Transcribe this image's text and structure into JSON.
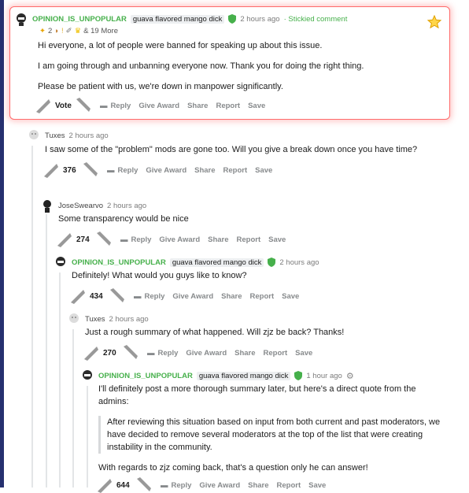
{
  "comments": [
    {
      "username": "OPINION_IS_UNPOPULAR",
      "flair": "guava flavored mango dick",
      "time": "2 hours ago",
      "stickied": "· Stickied comment",
      "awards_count": "2",
      "awards_more": "& 19 More",
      "paragraphs": [
        "Hi everyone, a lot of people were banned for speaking up about this issue.",
        "I am going through and unbanning everyone now. Thank you for doing the right thing.",
        "Please be patient with us, we're down in manpower significantly."
      ],
      "vote": "Vote"
    },
    {
      "username": "Tuxes",
      "time": "2 hours ago",
      "paragraphs": [
        "I saw some of the \"problem\" mods are gone too. Will you give a break down once you have time?"
      ],
      "vote": "376"
    },
    {
      "username": "JoseSwearvo",
      "time": "2 hours ago",
      "paragraphs": [
        "Some transparency would be nice"
      ],
      "vote": "274"
    },
    {
      "username": "OPINION_IS_UNPOPULAR",
      "flair": "guava flavored mango dick",
      "time": "2 hours ago",
      "paragraphs": [
        "Definitely! What would you guys like to know?"
      ],
      "vote": "434"
    },
    {
      "username": "Tuxes",
      "time": "2 hours ago",
      "paragraphs": [
        "Just a rough summary of what happened. Will zjz be back? Thanks!"
      ],
      "vote": "270"
    },
    {
      "username": "OPINION_IS_UNPOPULAR",
      "flair": "guava flavored mango dick",
      "time": "1 hour ago",
      "paragraph1": "I'll definitely post a more thorough summary later, but here's a direct quote from the admins:",
      "quote": "After reviewing this situation based on input from both current and past moderators, we have decided to remove several moderators at the top of the list that were creating instability in the community.",
      "paragraph2": "With regards to zjz coming back, that's a question only he can answer!",
      "vote": "644"
    }
  ],
  "actions": {
    "reply": "Reply",
    "give_award": "Give Award",
    "share": "Share",
    "report": "Report",
    "save": "Save"
  },
  "colors": {
    "op_username": "#46b04b",
    "highlight_border": "#ff6b6b",
    "left_bar": "#26306f"
  }
}
